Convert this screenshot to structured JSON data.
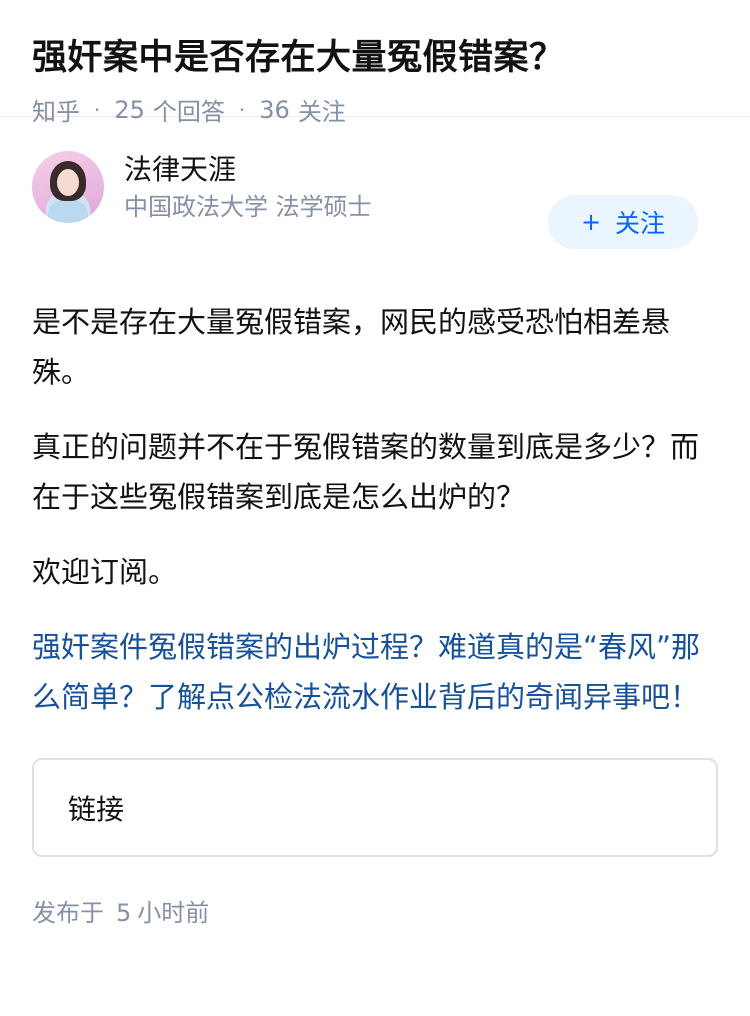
{
  "question": {
    "title": "强奸案中是否存在大量冤假错案？",
    "source": "知乎",
    "answers_count": "25",
    "answers_label": "个回答",
    "followers_count": "36",
    "followers_label": "关注"
  },
  "author": {
    "name": "法律天涯",
    "description": "中国政法大学 法学硕士",
    "follow_label": "关注",
    "follow_icon": "plus-icon"
  },
  "answer": {
    "paragraphs": [
      "是不是存在大量冤假错案，网民的感受恐怕相差悬殊。",
      "真正的问题并不在于冤假错案的数量到底是多少？而在于这些冤假错案到底是怎么出炉的？",
      "欢迎订阅。"
    ],
    "promo_link": "强奸案件冤假错案的出炉过程？难道真的是“春风”那么简单？了解点公检法流水作业背后的奇闻异事吧！",
    "link_card_label": "链接"
  },
  "footer": {
    "published_prefix": "发布于",
    "published_count": "5",
    "published_unit": "小时前"
  },
  "colors": {
    "link": "#175199",
    "follow_button_bg": "#ebf5ff",
    "follow_button_text": "#0066ff",
    "meta_gray": "#8590a6"
  }
}
